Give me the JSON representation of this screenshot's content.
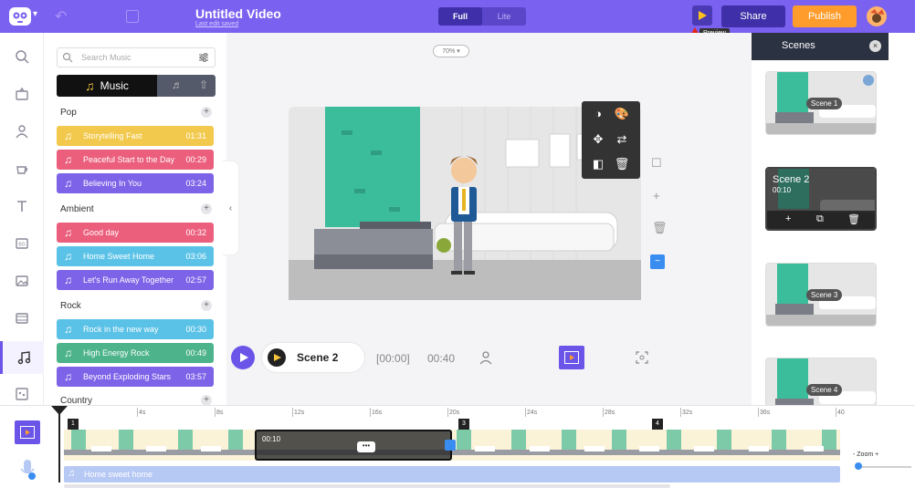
{
  "header": {
    "title": "Untitled Video",
    "subtitle": "Last edit saved",
    "mode_full": "Full",
    "mode_lite": "Lite",
    "share_label": "Share",
    "publish_label": "Publish",
    "preview_tooltip": "Preview"
  },
  "colors": {
    "brand": "#7b61f0",
    "publish": "#ff9c2b",
    "accent_blue": "#3a8df0"
  },
  "rail": {
    "items": [
      {
        "icon": "search-icon"
      },
      {
        "icon": "properties-icon"
      },
      {
        "icon": "character-icon"
      },
      {
        "icon": "props-cup-icon"
      },
      {
        "icon": "text-icon"
      },
      {
        "icon": "background-icon"
      },
      {
        "icon": "image-icon"
      },
      {
        "icon": "video-icon"
      },
      {
        "icon": "music-icon",
        "active": true
      },
      {
        "icon": "effects-icon"
      }
    ]
  },
  "music": {
    "search_placeholder": "Search Music",
    "tab_music": "Music",
    "categories": [
      {
        "name": "Pop",
        "tracks": [
          {
            "name": "Storytelling Fast",
            "duration": "01:31",
            "color": "#f2c94c"
          },
          {
            "name": "Peaceful Start to the Day",
            "duration": "00:29",
            "color": "#eb5f7d"
          },
          {
            "name": "Believing In You",
            "duration": "03:24",
            "color": "#7c63e8"
          }
        ]
      },
      {
        "name": "Ambient",
        "tracks": [
          {
            "name": "Good day",
            "duration": "00:32",
            "color": "#eb5f7d"
          },
          {
            "name": "Home Sweet Home",
            "duration": "03:06",
            "color": "#5bc2e7"
          },
          {
            "name": "Let's Run Away Together",
            "duration": "02:57",
            "color": "#7c63e8"
          }
        ]
      },
      {
        "name": "Rock",
        "tracks": [
          {
            "name": "Rock in the new way",
            "duration": "00:30",
            "color": "#5bc2e7"
          },
          {
            "name": "High Energy Rock",
            "duration": "00:49",
            "color": "#4cb38b"
          },
          {
            "name": "Beyond Exploding Stars",
            "duration": "03:57",
            "color": "#7c63e8"
          }
        ]
      },
      {
        "name": "Country",
        "tracks": []
      }
    ]
  },
  "stage": {
    "zoom": "70%"
  },
  "playback": {
    "scene_label": "Scene 2",
    "current_time": "[00:00]",
    "total_time": "00:40"
  },
  "scenes_panel": {
    "title": "Scenes",
    "scenes": [
      {
        "label": "Scene 1"
      },
      {
        "label": "Scene 2",
        "duration": "00:10",
        "selected": true
      },
      {
        "label": "Scene 3"
      },
      {
        "label": "Scene 4"
      }
    ]
  },
  "timeline": {
    "ruler": [
      "4s",
      "8s",
      "12s",
      "16s",
      "20s",
      "24s",
      "28s",
      "32s",
      "36s",
      "40"
    ],
    "segments": [
      "1",
      "3",
      "4"
    ],
    "selected_duration": "00:10",
    "more_label": "•••",
    "audio_track": "Home sweet home",
    "zoom_label": "- Zoom +"
  }
}
